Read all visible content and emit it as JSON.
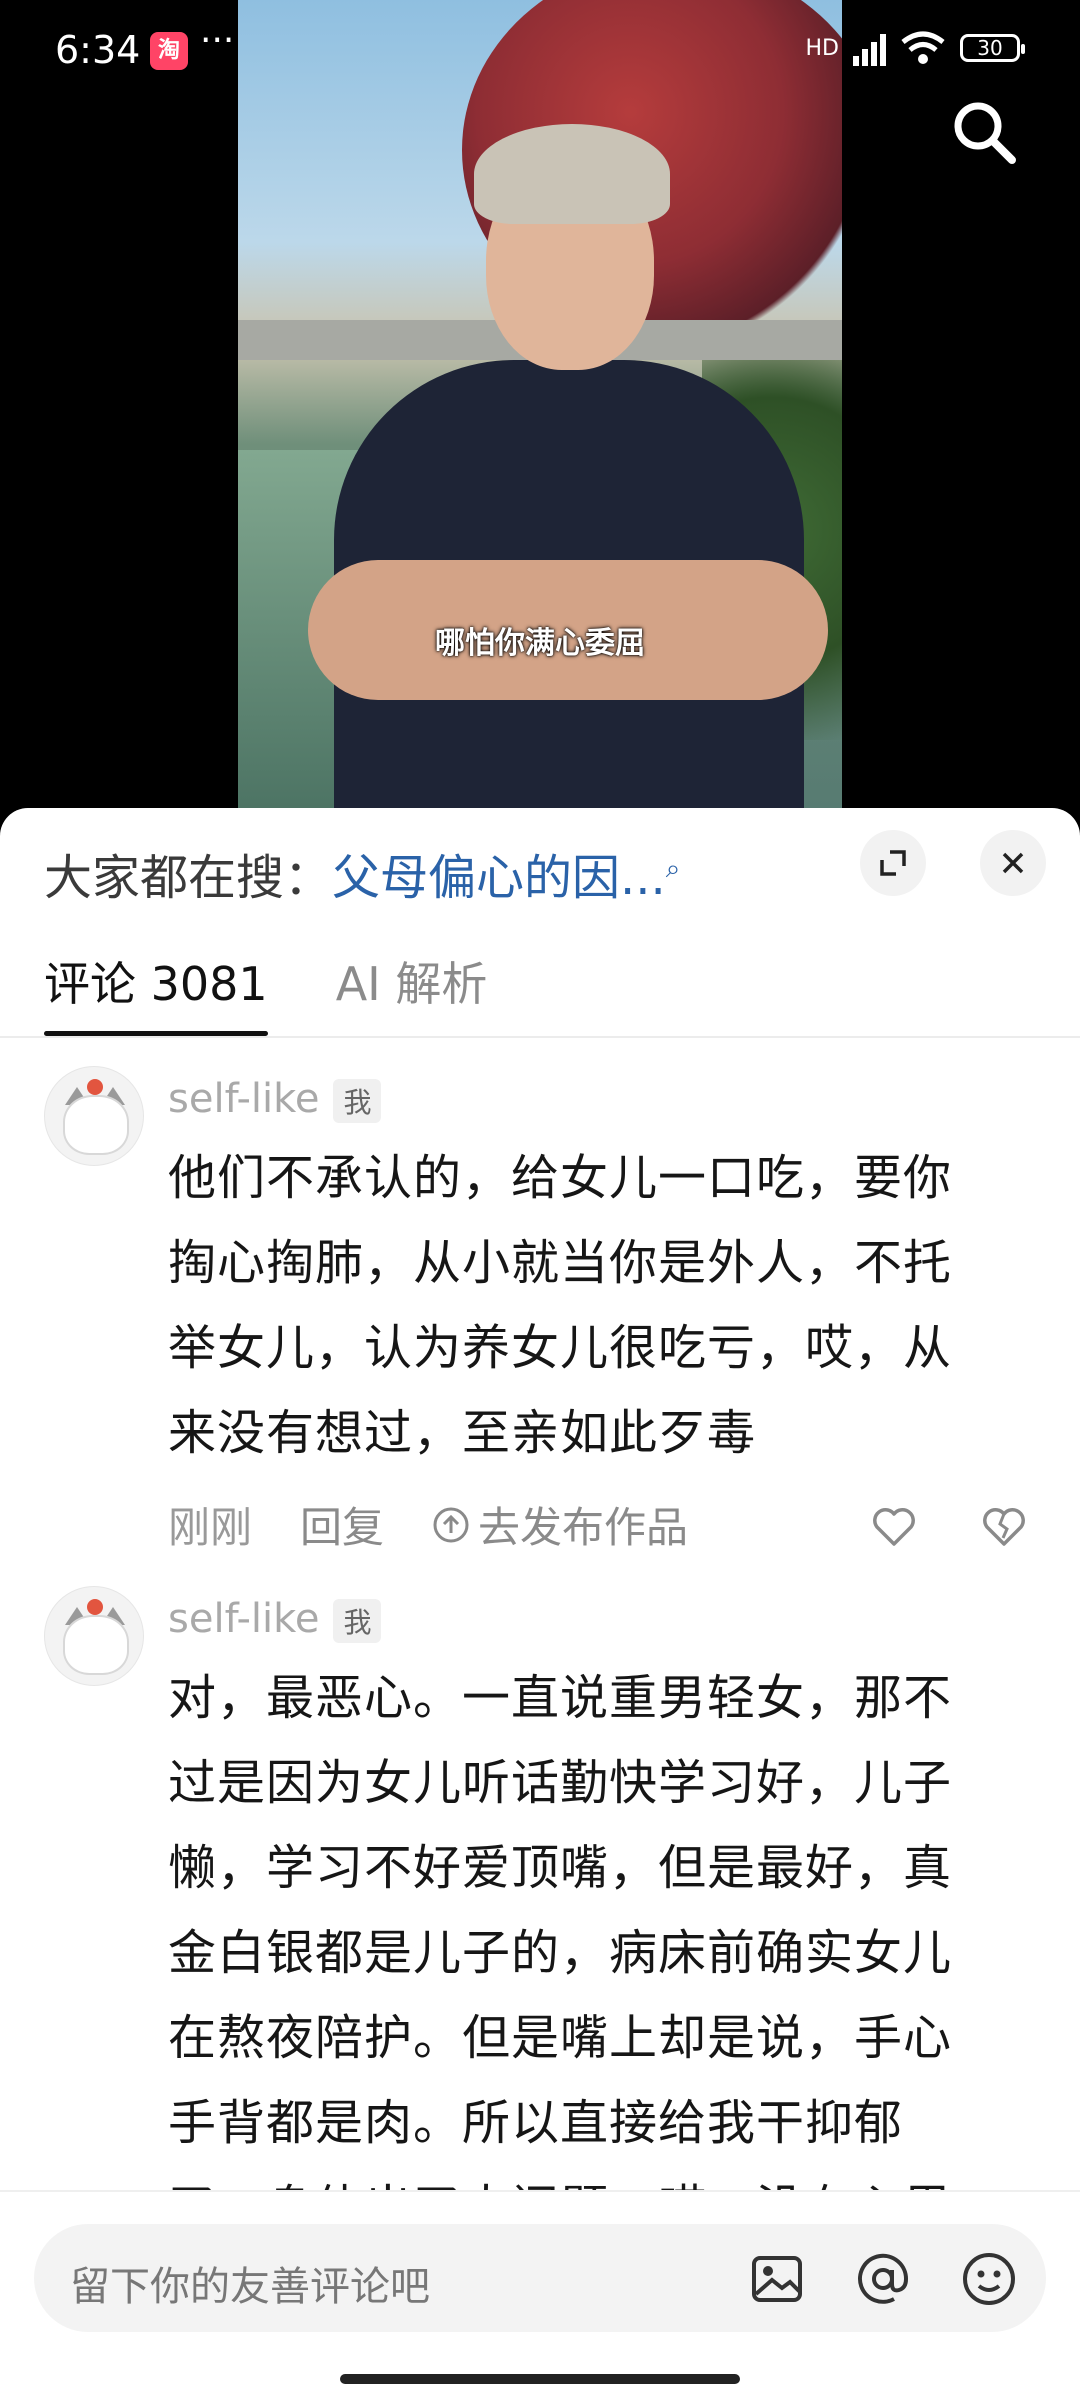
{
  "status_bar": {
    "time": "6:34",
    "taobao_icon_label": "淘",
    "more": "···",
    "network": "HD",
    "battery": "30"
  },
  "video": {
    "subtitle": "哪怕你满心委屈"
  },
  "sheet": {
    "trend_prefix": "大家都在搜：",
    "trend_keyword": "父母偏心的因...",
    "tabs": [
      {
        "label": "评论 3081"
      },
      {
        "label": "AI 解析"
      }
    ]
  },
  "comments": [
    {
      "user": "self-like",
      "tag": "我",
      "lines": [
        "他们不承认的，给女儿一口吃，要你",
        "掏心掏肺，从小就当你是外人，不托",
        "举女儿，认为养女儿很吃亏，哎，从",
        "来没有想过，至亲如此歹毒"
      ],
      "time": "刚刚",
      "reply": "回复",
      "publish": "去发布作品"
    },
    {
      "user": "self-like",
      "tag": "我",
      "lines": [
        "对，最恶心。一直说重男轻女，那不",
        "过是因为女儿听话勤快学习好，儿子",
        "懒，学习不好爱顶嘴，但是最好，真",
        "金白银都是儿子的，病床前确实女儿",
        "在熬夜陪护。但是嘴上却是说，手心",
        "手背都是肉。所以直接给我干抑郁",
        "了，身体出了大问题，哎，没有心里"
      ]
    }
  ],
  "input": {
    "placeholder": "留下你的友善评论吧"
  },
  "icons": {
    "search": "search-icon",
    "expand": "expand-icon",
    "close": "close-icon",
    "like": "heart-icon",
    "dislike": "broken-heart-icon",
    "image": "image-icon",
    "mention": "at-icon",
    "emoji": "emoji-icon"
  }
}
